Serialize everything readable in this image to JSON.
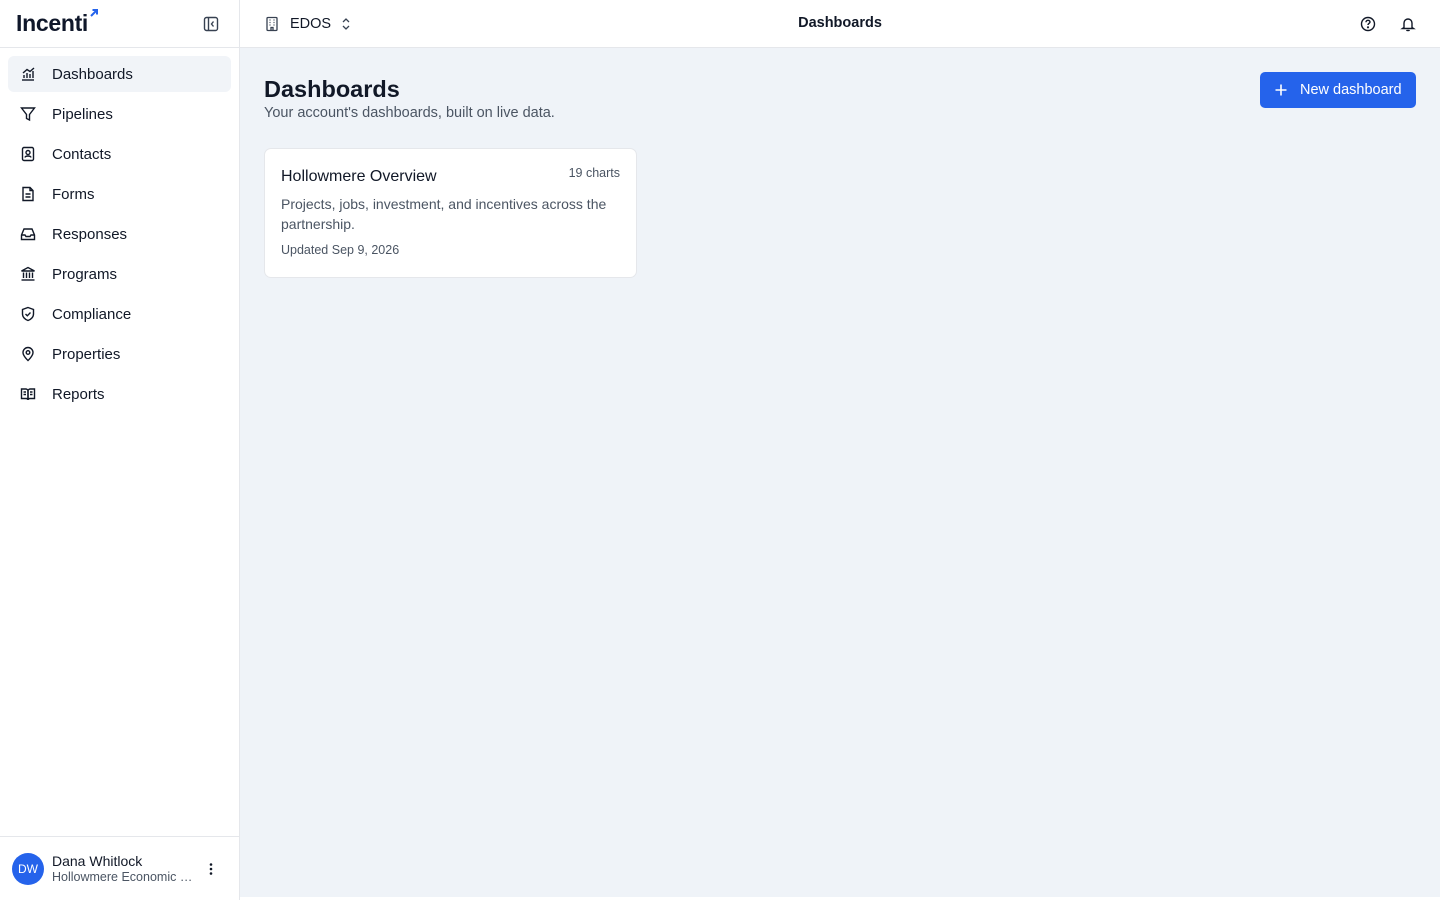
{
  "brand": {
    "name": "Incenti",
    "accent": "#2563eb"
  },
  "sidebar": {
    "items": [
      {
        "label": "Dashboards",
        "icon": "chart-icon",
        "active": true
      },
      {
        "label": "Pipelines",
        "icon": "filter-icon"
      },
      {
        "label": "Contacts",
        "icon": "contact-book-icon"
      },
      {
        "label": "Forms",
        "icon": "document-icon"
      },
      {
        "label": "Responses",
        "icon": "inbox-icon"
      },
      {
        "label": "Programs",
        "icon": "bank-icon"
      },
      {
        "label": "Compliance",
        "icon": "shield-check-icon"
      },
      {
        "label": "Properties",
        "icon": "map-pin-icon"
      },
      {
        "label": "Reports",
        "icon": "open-book-icon"
      }
    ]
  },
  "user": {
    "initials": "DW",
    "name": "Dana Whitlock",
    "org": "Hollowmere Economic Development Organization"
  },
  "topbar": {
    "workspace": "EDOS",
    "title": "Dashboards"
  },
  "main": {
    "title": "Dashboards",
    "subtitle": "Your account's dashboards, built on live data.",
    "new_button": "New dashboard",
    "cards": [
      {
        "title": "Hollowmere Overview",
        "count": "19 charts",
        "description": "Projects, jobs, investment, and incentives across the partnership.",
        "updated": "Updated Sep 9, 2026"
      }
    ]
  }
}
